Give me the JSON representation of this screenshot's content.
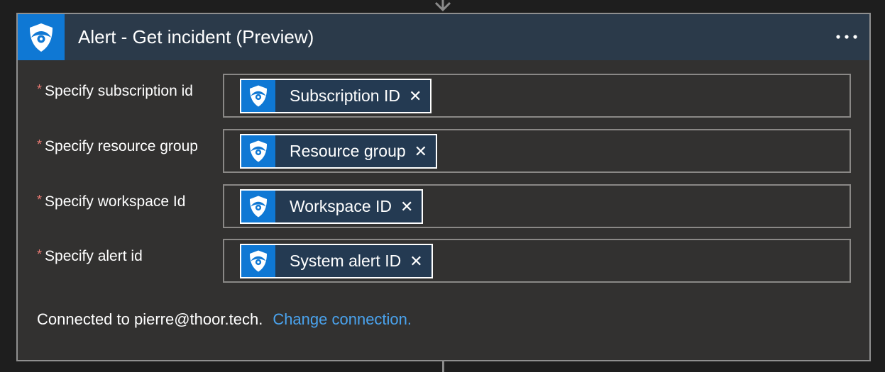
{
  "card": {
    "title": "Alert - Get incident (Preview)",
    "header_icon": "shield-eye-icon",
    "more_icon": "more-options-icon"
  },
  "fields": [
    {
      "label": "Specify subscription id",
      "required": "*",
      "token": "Subscription ID",
      "remove": "✕"
    },
    {
      "label": "Specify resource group",
      "required": "*",
      "token": "Resource group",
      "remove": "✕"
    },
    {
      "label": "Specify workspace Id",
      "required": "*",
      "token": "Workspace ID",
      "remove": "✕"
    },
    {
      "label": "Specify alert id",
      "required": "*",
      "token": "System alert ID",
      "remove": "✕"
    }
  ],
  "connection": {
    "text": "Connected to pierre@thoor.tech.",
    "change_link": "Change connection."
  },
  "colors": {
    "header_bg": "#2b3a4a",
    "icon_blue": "#0f78d4",
    "card_bg": "#323130",
    "link": "#4aa3ee",
    "required": "#e87a72"
  }
}
